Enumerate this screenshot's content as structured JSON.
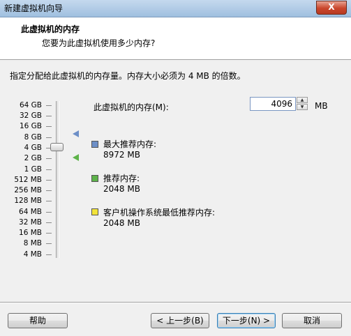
{
  "window": {
    "title": "新建虚拟机向导",
    "close_label": "X"
  },
  "header": {
    "title": "此虚拟机的内存",
    "subtitle": "您要为此虚拟机使用多少内存?"
  },
  "instruction": "指定分配给此虚拟机的内存量。内存大小必须为 4 MB 的倍数。",
  "memory_scale": {
    "ticks": [
      "64 GB",
      "32 GB",
      "16 GB",
      "8 GB",
      "4 GB",
      "2 GB",
      "1 GB",
      "512 MB",
      "256 MB",
      "128 MB",
      "64 MB",
      "32 MB",
      "16 MB",
      "8 MB",
      "4 MB"
    ],
    "slider_value_label": "4 GB"
  },
  "memory": {
    "label": "此虚拟机的内存(M):",
    "value": "4096",
    "unit": "MB"
  },
  "recommendations": [
    {
      "label": "最大推荐内存:",
      "value": "8972 MB",
      "color": "#6d8fc7"
    },
    {
      "label": "推荐内存:",
      "value": "2048 MB",
      "color": "#5eb34a"
    },
    {
      "label": "客户机操作系统最低推荐内存:",
      "value": "2048 MB",
      "color": "#f2e33a"
    }
  ],
  "buttons": {
    "help": "帮助",
    "back": "< 上一步(B)",
    "next": "下一步(N) >",
    "cancel": "取消"
  }
}
